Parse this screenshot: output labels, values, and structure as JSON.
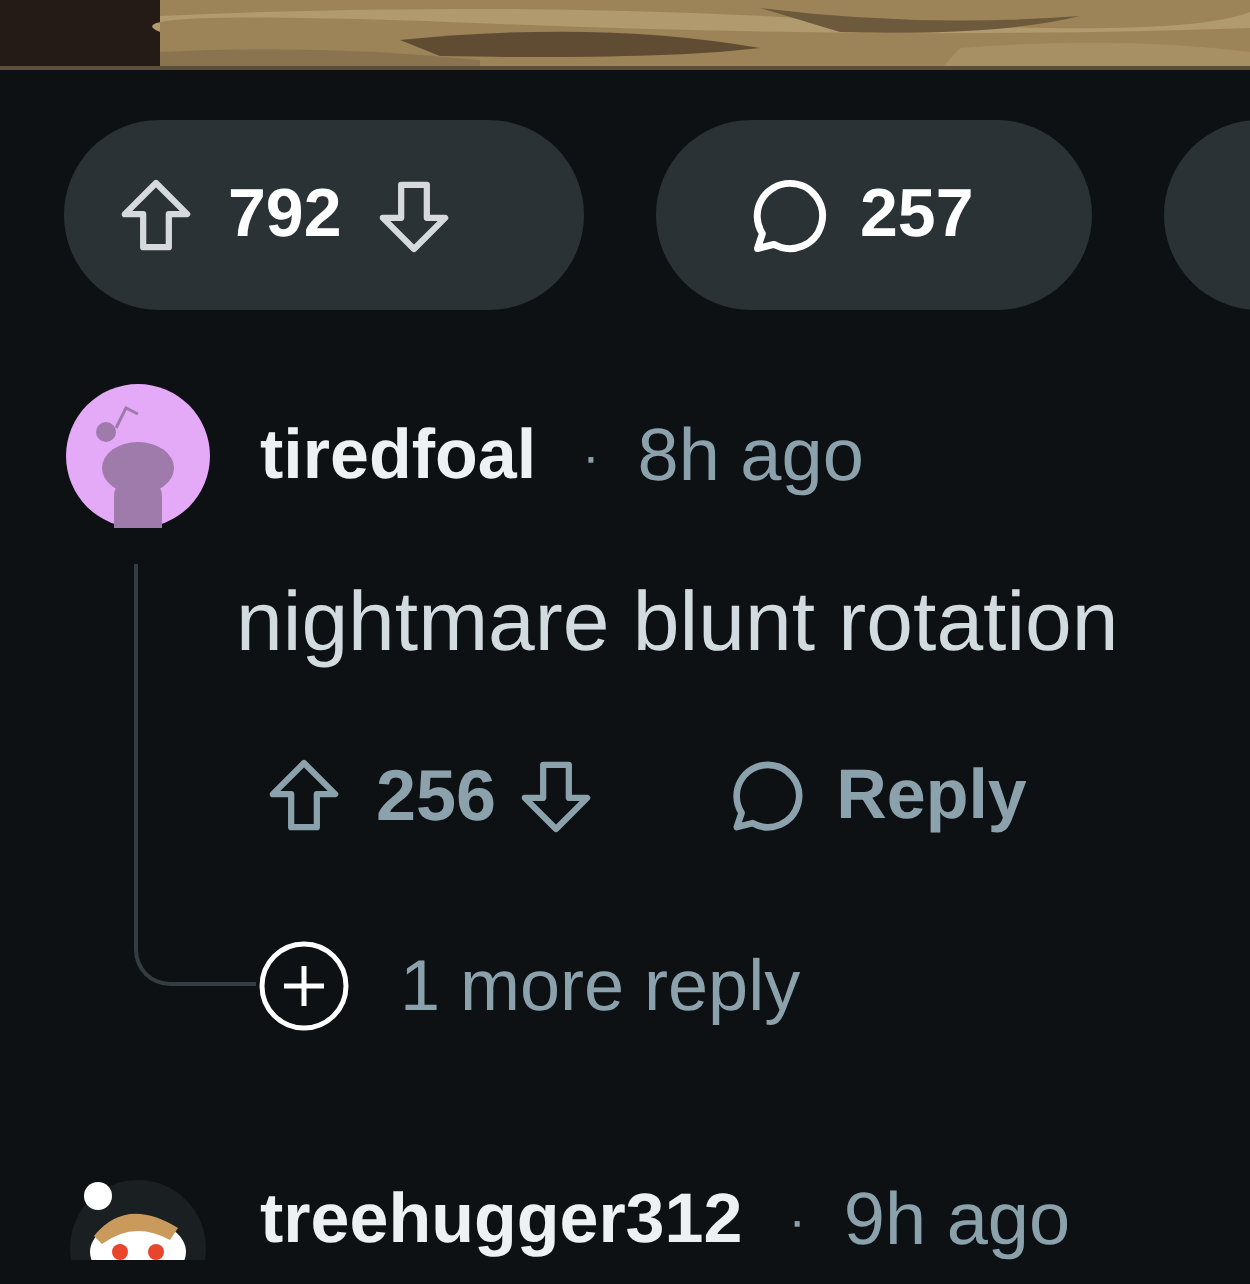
{
  "post_actions": {
    "score": "792",
    "comment_count": "257"
  },
  "comments": [
    {
      "author": "tiredfoal",
      "separator": "·",
      "time": "8h ago",
      "avatar": {
        "kind": "purple"
      },
      "body": "nightmare blunt rotation",
      "score": "256",
      "reply_label": "Reply",
      "more_replies": "1 more reply"
    },
    {
      "author": "treehugger312",
      "separator": "·",
      "time": "9h ago",
      "avatar": {
        "kind": "character"
      }
    }
  ]
}
